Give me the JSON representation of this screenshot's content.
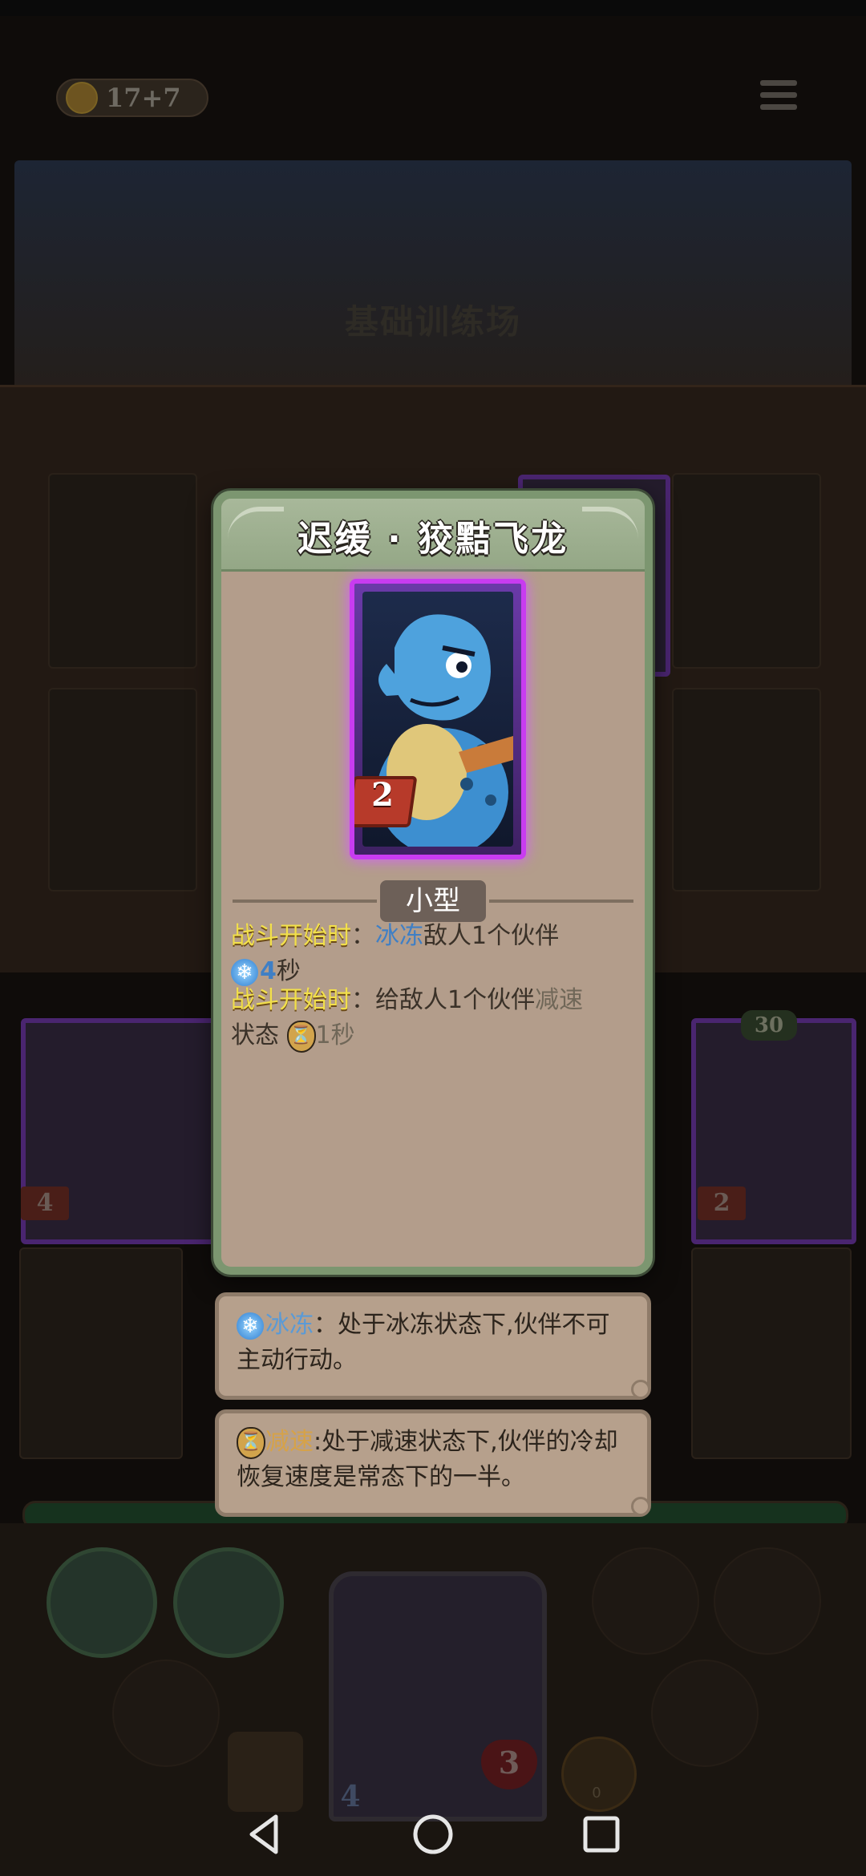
{
  "hud": {
    "coins": "17+7",
    "menu_icon": "hamburger-menu-icon"
  },
  "scene": {
    "title": "基础训练场"
  },
  "modal": {
    "title": "迟缓 · 狡黠飞龙",
    "card": {
      "cost": "2",
      "frame_color": "#c83cf0",
      "art": "blue-dragon"
    },
    "size_tag": "小型",
    "abilities": [
      {
        "trigger": "战斗开始时",
        "sep": "：",
        "keyword": "冰冻",
        "text": "敌人1个伙伴",
        "icon": "snowflake-icon",
        "value": "4",
        "unit": "秒"
      },
      {
        "trigger": "战斗开始时",
        "sep": "：",
        "text_before": "给敌人1个伙伴",
        "keyword": "减速",
        "text_after": "状态",
        "icon": "slow-icon",
        "value": "1秒"
      }
    ]
  },
  "tooltips": [
    {
      "icon": "snowflake-icon",
      "keyword": "冰冻",
      "text": "：处于冰冻状态下,伙伴不可主动行动。"
    },
    {
      "icon": "slow-icon",
      "keyword": "减速",
      "text": ":处于减速状态下,伙伴的冷却恢复速度是常态下的一半。"
    }
  ],
  "background_cards": {
    "left_card_cost": "4",
    "right_card_cost": "2",
    "right_card_hp": "30"
  },
  "hero": {
    "health": "3",
    "shield": "4",
    "trophy_count": "0"
  },
  "colors": {
    "modal_bg": "#b39d8b",
    "modal_border": "#7c9670",
    "trigger_gold": "#f2e04b",
    "keyword_blue": "#3f7fc5"
  }
}
